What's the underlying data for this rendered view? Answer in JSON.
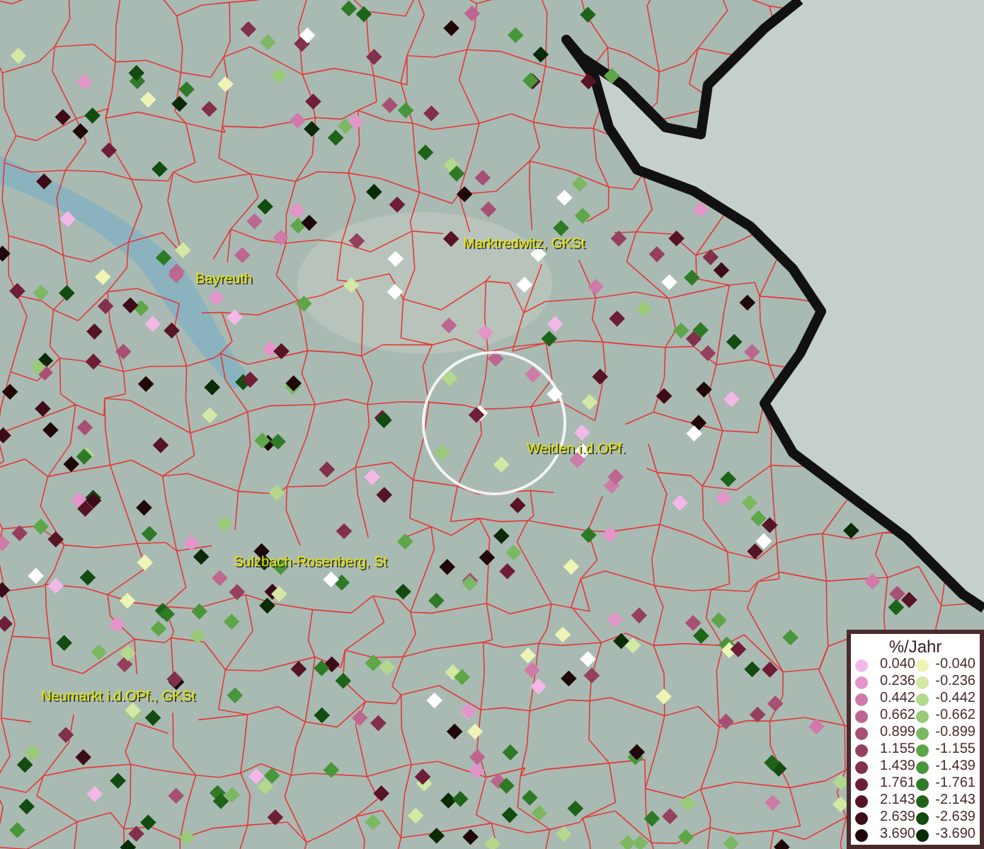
{
  "map": {
    "places": [
      {
        "name": "Marktredwitz, GKSt"
      },
      {
        "name": "Bayreuth"
      },
      {
        "name": "Weiden i.d.OPf."
      },
      {
        "name": "Sulzbach-Rosenberg, St"
      },
      {
        "name": "Neumarkt i.d.OPf., GKSt"
      }
    ]
  },
  "legend": {
    "title": "%/Jahr",
    "positive": [
      {
        "label": "0.040",
        "color": "#f4b8e8"
      },
      {
        "label": "0.236",
        "color": "#e394c8"
      },
      {
        "label": "0.442",
        "color": "#cf7aa8"
      },
      {
        "label": "0.662",
        "color": "#bd6690"
      },
      {
        "label": "0.899",
        "color": "#a84f74"
      },
      {
        "label": "1.155",
        "color": "#94405e"
      },
      {
        "label": "1.439",
        "color": "#82304c"
      },
      {
        "label": "1.761",
        "color": "#6e1e36"
      },
      {
        "label": "2.143",
        "color": "#561424"
      },
      {
        "label": "2.639",
        "color": "#3e0c18"
      },
      {
        "label": "3.690",
        "color": "#200808"
      }
    ],
    "negative": [
      {
        "label": "-0.040",
        "color": "#eef5b4"
      },
      {
        "label": "-0.236",
        "color": "#d2e8a4"
      },
      {
        "label": "-0.442",
        "color": "#b4d88c"
      },
      {
        "label": "-0.662",
        "color": "#98ca78"
      },
      {
        "label": "-0.899",
        "color": "#7cb862"
      },
      {
        "label": "-1.155",
        "color": "#5ea648"
      },
      {
        "label": "-1.439",
        "color": "#48963a"
      },
      {
        "label": "-1.761",
        "color": "#2e7a26"
      },
      {
        "label": "-2.143",
        "color": "#1e6418"
      },
      {
        "label": "-2.639",
        "color": "#124c10"
      },
      {
        "label": "-3.690",
        "color": "#0a2a08"
      }
    ]
  }
}
